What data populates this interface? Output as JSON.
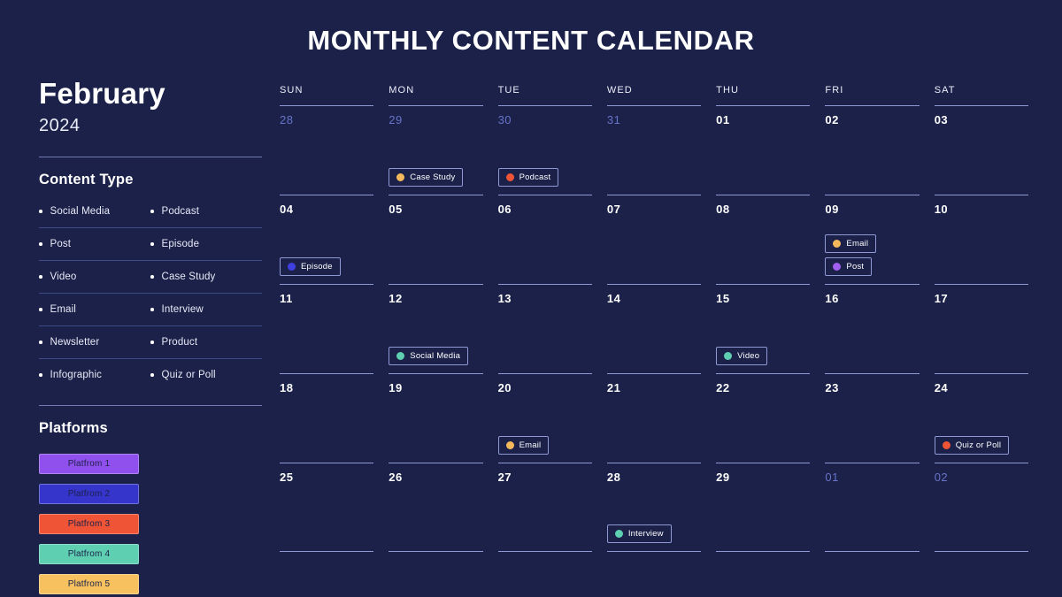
{
  "header": {
    "title": "MONTHLY CONTENT CALENDAR"
  },
  "sidebar": {
    "month": "February",
    "year": "2024",
    "content_type": {
      "heading": "Content Type",
      "rows": [
        {
          "left": "Social Media",
          "right": "Podcast"
        },
        {
          "left": "Post",
          "right": "Episode"
        },
        {
          "left": "Video",
          "right": "Case Study"
        },
        {
          "left": "Email",
          "right": "Interview"
        },
        {
          "left": "Newsletter",
          "right": "Product"
        },
        {
          "left": "Infographic",
          "right": "Quiz or Poll"
        }
      ]
    },
    "platforms": {
      "heading": "Platforms",
      "items": [
        {
          "label": "Platfrom 1",
          "color": "#9050ed"
        },
        {
          "label": "Platfrom 2",
          "color": "#3535cc"
        },
        {
          "label": "Platfrom 3",
          "color": "#ee5435"
        },
        {
          "label": "Platfrom 4",
          "color": "#5ecfb1"
        },
        {
          "label": "Platfrom 5",
          "color": "#f7c160"
        }
      ]
    }
  },
  "calendar": {
    "weekdays": [
      "SUN",
      "MON",
      "TUE",
      "WED",
      "THU",
      "FRI",
      "SAT"
    ],
    "colors": {
      "divider": "#8f9ad4",
      "muted_day": "#6874c9",
      "background": "#1b2149"
    },
    "event_colors": {
      "case_study": "#f4b95a",
      "podcast": "#ee5435",
      "episode": "#4040e0",
      "email": "#f4b95a",
      "post": "#a15ef0",
      "social_media": "#5ecfb1",
      "video": "#5ecfb1",
      "quiz_or_poll": "#ee5435",
      "interview": "#5ecfb1"
    },
    "weeks": [
      [
        {
          "day": "28",
          "muted": true,
          "events": []
        },
        {
          "day": "29",
          "muted": true,
          "events": [
            {
              "label": "Case Study",
              "color": "#f4b95a"
            }
          ]
        },
        {
          "day": "30",
          "muted": true,
          "events": [
            {
              "label": "Podcast",
              "color": "#ee5435"
            }
          ]
        },
        {
          "day": "31",
          "muted": true,
          "events": []
        },
        {
          "day": "01",
          "muted": false,
          "events": []
        },
        {
          "day": "02",
          "muted": false,
          "events": []
        },
        {
          "day": "03",
          "muted": false,
          "events": []
        }
      ],
      [
        {
          "day": "04",
          "muted": false,
          "events": [
            {
              "label": "Episode",
              "color": "#4040e0"
            }
          ]
        },
        {
          "day": "05",
          "muted": false,
          "events": []
        },
        {
          "day": "06",
          "muted": false,
          "events": []
        },
        {
          "day": "07",
          "muted": false,
          "events": []
        },
        {
          "day": "08",
          "muted": false,
          "events": []
        },
        {
          "day": "09",
          "muted": false,
          "events": [
            {
              "label": "Post",
              "color": "#a15ef0"
            },
            {
              "label": "Email",
              "color": "#f4b95a"
            }
          ]
        },
        {
          "day": "10",
          "muted": false,
          "events": []
        }
      ],
      [
        {
          "day": "11",
          "muted": false,
          "events": []
        },
        {
          "day": "12",
          "muted": false,
          "events": [
            {
              "label": "Social Media",
              "color": "#5ecfb1"
            }
          ]
        },
        {
          "day": "13",
          "muted": false,
          "events": []
        },
        {
          "day": "14",
          "muted": false,
          "events": []
        },
        {
          "day": "15",
          "muted": false,
          "events": [
            {
              "label": "Video",
              "color": "#5ecfb1"
            }
          ]
        },
        {
          "day": "16",
          "muted": false,
          "events": []
        },
        {
          "day": "17",
          "muted": false,
          "events": []
        }
      ],
      [
        {
          "day": "18",
          "muted": false,
          "events": []
        },
        {
          "day": "19",
          "muted": false,
          "events": []
        },
        {
          "day": "20",
          "muted": false,
          "events": [
            {
              "label": "Email",
              "color": "#f4b95a"
            }
          ]
        },
        {
          "day": "21",
          "muted": false,
          "events": []
        },
        {
          "day": "22",
          "muted": false,
          "events": []
        },
        {
          "day": "23",
          "muted": false,
          "events": []
        },
        {
          "day": "24",
          "muted": false,
          "events": [
            {
              "label": "Quiz or Poll",
              "color": "#ee5435"
            }
          ]
        }
      ],
      [
        {
          "day": "25",
          "muted": false,
          "events": []
        },
        {
          "day": "26",
          "muted": false,
          "events": []
        },
        {
          "day": "27",
          "muted": false,
          "events": []
        },
        {
          "day": "28",
          "muted": false,
          "events": [
            {
              "label": "Interview",
              "color": "#5ecfb1"
            }
          ]
        },
        {
          "day": "29",
          "muted": false,
          "events": []
        },
        {
          "day": "01",
          "muted": true,
          "events": []
        },
        {
          "day": "02",
          "muted": true,
          "events": []
        }
      ]
    ]
  }
}
